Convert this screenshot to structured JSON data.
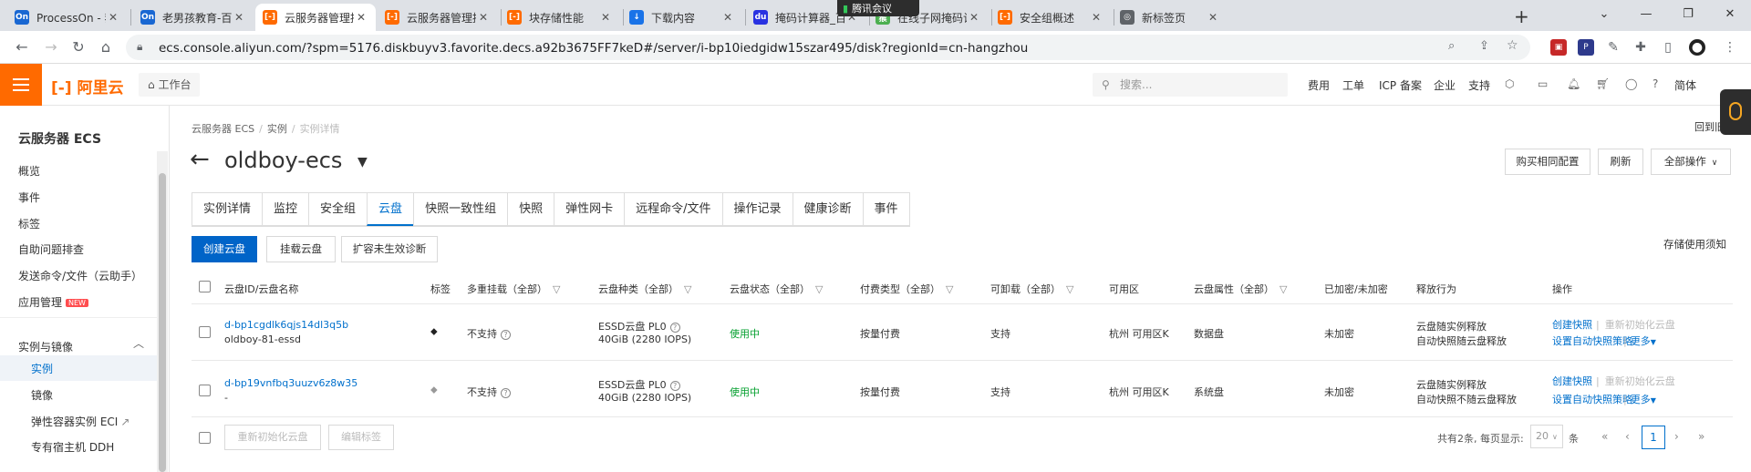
{
  "browser": {
    "tabs": [
      {
        "title": "ProcessOn - 我的",
        "favicon": "On",
        "color": "#1967d2"
      },
      {
        "title": "老男孩教育-百台",
        "favicon": "On",
        "color": "#1967d2"
      },
      {
        "title": "云服务器管理控制",
        "favicon": "[-]",
        "color": "#ff6a00"
      },
      {
        "title": "云服务器管理控制",
        "favicon": "[-]",
        "color": "#ff6a00"
      },
      {
        "title": "块存储性能",
        "favicon": "[-]",
        "color": "#ff6a00"
      },
      {
        "title": "下载内容",
        "favicon": "↓",
        "color": "#1a73e8"
      },
      {
        "title": "掩码计算器_百度搜",
        "favicon": "du",
        "color": "#2932e1"
      },
      {
        "title": "在线子网掩码计算",
        "favicon": "猴",
        "color": "#4caf50"
      },
      {
        "title": "安全组概述",
        "favicon": "[-]",
        "color": "#ff6a00"
      },
      {
        "title": "新标签页",
        "favicon": "◎",
        "color": "#5f6368"
      }
    ],
    "new_tab": "+",
    "meeting_label": "腾讯会议",
    "url": "ecs.console.aliyun.com/?spm=5176.diskbuyv3.favorite.decs.a92b3675FF7keD#/server/i-bp10iedgidw15szar495/disk?regionId=cn-hangzhou"
  },
  "header": {
    "brand": "阿里云",
    "workbench": "工作台",
    "search_placeholder": "搜索...",
    "links": [
      "费用",
      "工单",
      "ICP 备案",
      "企业",
      "支持"
    ],
    "lang": "简体"
  },
  "sidebar": {
    "title": "云服务器 ECS",
    "items": [
      "概览",
      "事件",
      "标签",
      "自助问题排查",
      "发送命令/文件（云助手）",
      "应用管理"
    ],
    "new_badge": "NEW",
    "group": "实例与镜像",
    "sub_items": [
      "实例",
      "镜像",
      "弹性容器实例 ECI",
      "专有宿主机 DDH"
    ]
  },
  "breadcrumb": [
    "云服务器 ECS",
    "实例",
    "实例详情"
  ],
  "page": {
    "title": "oldboy-ecs",
    "top_buttons": [
      "购买相同配置",
      "刷新",
      "全部操作"
    ],
    "right_top_text": "回到旧版",
    "tabs": [
      "实例详情",
      "监控",
      "安全组",
      "云盘",
      "快照一致性组",
      "快照",
      "弹性网卡",
      "远程命令/文件",
      "操作记录",
      "健康诊断",
      "事件"
    ],
    "active_tab": 3,
    "actions": [
      "创建云盘",
      "挂载云盘",
      "扩容未生效诊断"
    ],
    "notice": "存储使用须知"
  },
  "table": {
    "headers": [
      "云盘ID/云盘名称",
      "标签",
      "多重挂载（全部）",
      "云盘种类（全部）",
      "云盘状态（全部）",
      "付费类型（全部）",
      "可卸载（全部）",
      "可用区",
      "云盘属性（全部）",
      "已加密/未加密",
      "释放行为",
      "操作"
    ],
    "rows": [
      {
        "id": "d-bp1cgdlk6qjs14dl3q5b",
        "name": "oldboy-81-essd",
        "multi_attach": "不支持",
        "category": "ESSD云盘  PL0",
        "size": "40GiB (2280 IOPS)",
        "status": "使用中",
        "pay_type": "按量付费",
        "detachable": "支持",
        "zone": "杭州 可用区K",
        "attr": "数据盘",
        "encrypted": "未加密",
        "release": [
          "云盘随实例释放",
          "自动快照随云盘释放"
        ],
        "ops": [
          "创建快照",
          "重新初始化云盘",
          "设置自动快照策略",
          "更多"
        ]
      },
      {
        "id": "d-bp19vnfbq3uuzv6z8w35",
        "name": "-",
        "multi_attach": "不支持",
        "category": "ESSD云盘  PL0",
        "size": "40GiB (2280 IOPS)",
        "status": "使用中",
        "pay_type": "按量付费",
        "detachable": "支持",
        "zone": "杭州 可用区K",
        "attr": "系统盘",
        "encrypted": "未加密",
        "release": [
          "云盘随实例释放",
          "自动快照不随云盘释放"
        ],
        "ops": [
          "创建快照",
          "重新初始化云盘",
          "设置自动快照策略",
          "更多"
        ]
      }
    ],
    "footer_buttons": [
      "重新初始化云盘",
      "编辑标签"
    ],
    "page_info": "共有2条, 每页显示:",
    "page_size": "20",
    "page_unit": "条",
    "current_page": "1"
  }
}
